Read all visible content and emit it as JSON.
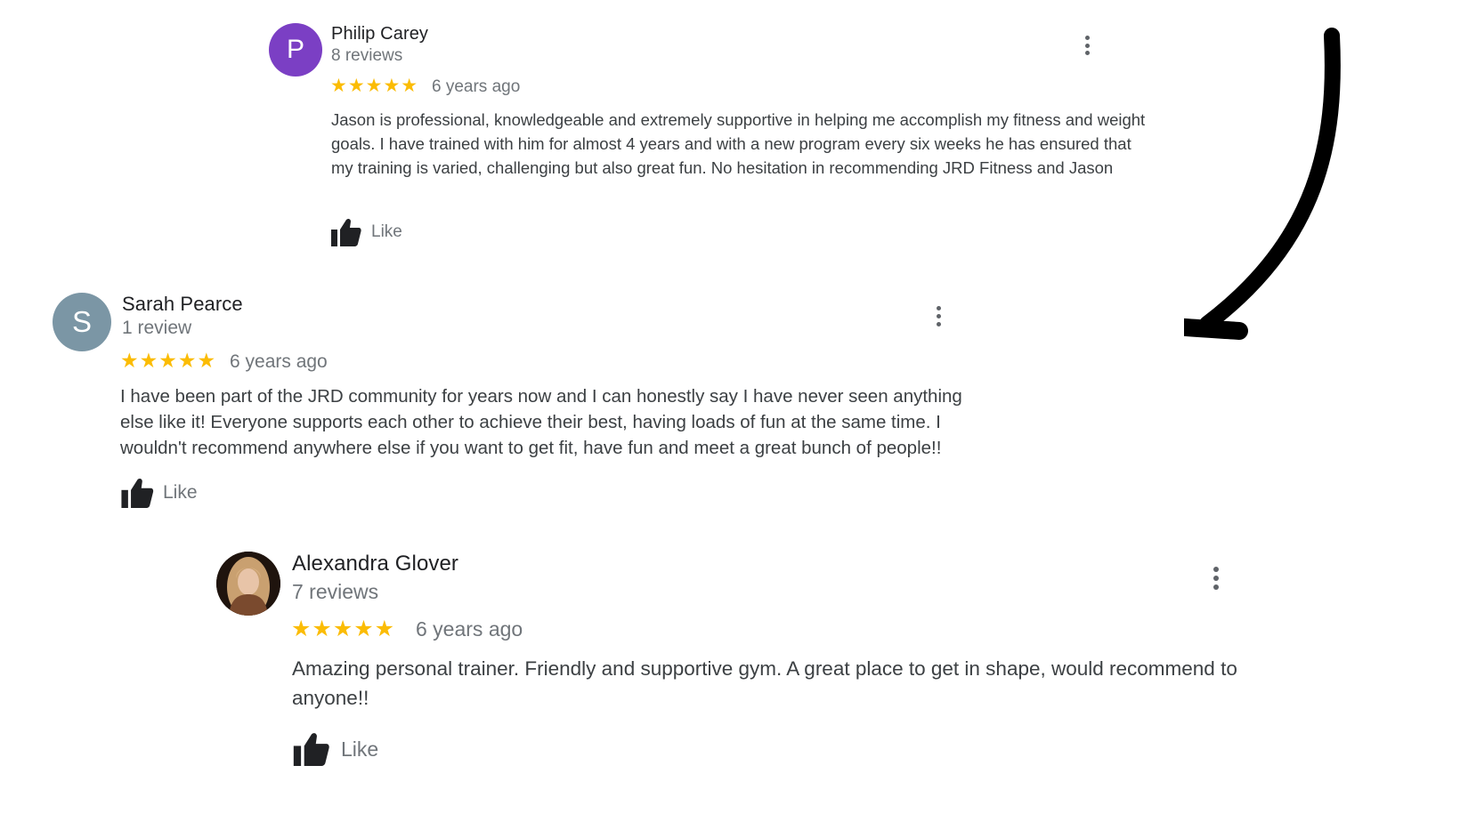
{
  "reviews": [
    {
      "author": "Philip Carey",
      "initial": "P",
      "avatar_color": "#7b3fc4",
      "review_count": "8 reviews",
      "rating": 5,
      "stars": "★★★★★",
      "time": "6 years ago",
      "text": "Jason is professional, knowledgeable and extremely supportive in helping me accomplish my fitness and weight goals. I have trained with him for almost 4 years and with a new program every six weeks he has ensured that my training is varied, challenging but also great fun. No hesitation in recommending JRD Fitness and Jason",
      "like_label": "Like",
      "more_icon": "more-vert-icon"
    },
    {
      "author": "Sarah Pearce",
      "initial": "S",
      "avatar_color": "#7b96a5",
      "review_count": "1 review",
      "rating": 5,
      "stars": "★★★★★",
      "time": "6 years ago",
      "text": "I have been part of the JRD community for years now and I can honestly say I have never seen anything else like it! Everyone supports each other to achieve their best, having loads of fun at the same time. I wouldn't recommend anywhere else if you want to get fit, have fun and meet a great bunch of people!!",
      "like_label": "Like",
      "more_icon": "more-vert-icon"
    },
    {
      "author": "Alexandra Glover",
      "avatar": "profile-photo",
      "review_count": "7 reviews",
      "rating": 5,
      "stars": "★★★★★",
      "time": "6 years ago",
      "text": "Amazing personal trainer. Friendly and supportive gym. A great place to get in shape, would recommend to anyone!!",
      "like_label": "Like",
      "more_icon": "more-vert-icon"
    }
  ],
  "colors": {
    "star": "#fbbc04",
    "secondary_text": "#70757a",
    "arrow": "#000000"
  },
  "decoration": {
    "arrow_icon": "curved-arrow-down-left-icon"
  }
}
